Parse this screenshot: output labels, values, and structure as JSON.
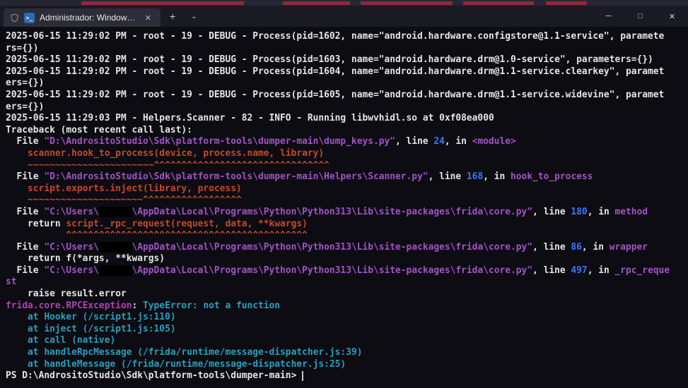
{
  "window": {
    "tab_title": "Administrador: Windows Pow...",
    "tab_icon_glyph": ">_",
    "controls": {
      "tab_close": "✕",
      "new_tab": "+",
      "tab_dropdown": "⌄",
      "minimize": "─",
      "maximize": "□",
      "close": "✕"
    }
  },
  "colors": {
    "terminal_bg": "#0c0c12",
    "titlebar_bg": "#1a1a24",
    "tab_bg": "#2d2d39",
    "text_default": "#e6e6e6",
    "text_path": "#a352c8",
    "text_line_number": "#3b78ff",
    "text_error_code": "#c3492b",
    "text_exception": "#ad41b4",
    "text_cyan": "#2b9fbd"
  },
  "terminal": {
    "lines": [
      [
        {
          "t": "2025-06-15 11:29:02 PM - root - 19 - DEBUG - Process(pid=1602, name=\"android.hardware.configstore@1.1-service\", paramete",
          "c": "fg"
        }
      ],
      [
        {
          "t": "rs={})",
          "c": "fg"
        }
      ],
      [
        {
          "t": "2025-06-15 11:29:02 PM - root - 19 - DEBUG - Process(pid=1603, name=\"android.hardware.drm@1.0-service\", parameters={})",
          "c": "fg"
        }
      ],
      [
        {
          "t": "2025-06-15 11:29:02 PM - root - 19 - DEBUG - Process(pid=1604, name=\"android.hardware.drm@1.1-service.clearkey\", paramet",
          "c": "fg"
        }
      ],
      [
        {
          "t": "ers={})",
          "c": "fg"
        }
      ],
      [
        {
          "t": "2025-06-15 11:29:02 PM - root - 19 - DEBUG - Process(pid=1605, name=\"android.hardware.drm@1.1-service.widevine\", paramet",
          "c": "fg"
        }
      ],
      [
        {
          "t": "ers={})",
          "c": "fg"
        }
      ],
      [
        {
          "t": "2025-06-15 11:29:03 PM - Helpers.Scanner - 82 - INFO - Running libwvhidl.so at 0xf08ea000",
          "c": "fg"
        }
      ],
      [
        {
          "t": "Traceback (most recent call last):",
          "c": "fg"
        }
      ],
      [
        {
          "t": "  File ",
          "c": "fg"
        },
        {
          "t": "\"D:\\AndrositoStudio\\Sdk\\platform-tools\\dumper-main\\dump_keys.py\"",
          "c": "path"
        },
        {
          "t": ", line ",
          "c": "fg"
        },
        {
          "t": "24",
          "c": "num"
        },
        {
          "t": ", in ",
          "c": "fg"
        },
        {
          "t": "<module>",
          "c": "path"
        }
      ],
      [
        {
          "t": "    ",
          "c": "fg"
        },
        {
          "t": "scanner.hook_to_process(device, process.name, library)",
          "c": "code"
        }
      ],
      [
        {
          "t": "    ",
          "c": "fg"
        },
        {
          "t": "~~~~~~~~~~~~~~~~~~~~~~~^^^^^^^^^^^^^^^^^^^^^^^^^^^^^^^^",
          "c": "code"
        }
      ],
      [
        {
          "t": "  File ",
          "c": "fg"
        },
        {
          "t": "\"D:\\AndrositoStudio\\Sdk\\platform-tools\\dumper-main\\Helpers\\Scanner.py\"",
          "c": "path"
        },
        {
          "t": ", line ",
          "c": "fg"
        },
        {
          "t": "168",
          "c": "num"
        },
        {
          "t": ", in ",
          "c": "fg"
        },
        {
          "t": "hook_to_process",
          "c": "path"
        }
      ],
      [
        {
          "t": "    ",
          "c": "fg"
        },
        {
          "t": "script.exports.inject(library, process)",
          "c": "code"
        }
      ],
      [
        {
          "t": "    ",
          "c": "fg"
        },
        {
          "t": "~~~~~~~~~~~~~~~~~~~~~^^^^^^^^^^^^^^^^^^",
          "c": "code"
        }
      ],
      [
        {
          "t": "  File ",
          "c": "fg"
        },
        {
          "t": "\"C:\\Users\\",
          "c": "path"
        },
        {
          "t": "      ",
          "c": "redact"
        },
        {
          "t": "\\AppData\\Local\\Programs\\Python\\Python313\\Lib\\site-packages\\frida\\core.py\"",
          "c": "path"
        },
        {
          "t": ", line ",
          "c": "fg"
        },
        {
          "t": "180",
          "c": "num"
        },
        {
          "t": ", in ",
          "c": "fg"
        },
        {
          "t": "method",
          "c": "path"
        }
      ],
      [
        {
          "t": "    return ",
          "c": "fg"
        },
        {
          "t": "script._rpc_request(request, data, **kwargs)",
          "c": "code"
        }
      ],
      [
        {
          "t": "           ",
          "c": "fg"
        },
        {
          "t": "^^^^^^^^^^^^^^^^^^^^^^^^^^^^^^^^^^^^^^^^^^^^",
          "c": "code"
        }
      ],
      [
        {
          "t": "  File ",
          "c": "fg"
        },
        {
          "t": "\"C:\\Users\\",
          "c": "path"
        },
        {
          "t": "      ",
          "c": "redact"
        },
        {
          "t": "\\AppData\\Local\\Programs\\Python\\Python313\\Lib\\site-packages\\frida\\core.py\"",
          "c": "path"
        },
        {
          "t": ", line ",
          "c": "fg"
        },
        {
          "t": "86",
          "c": "num"
        },
        {
          "t": ", in ",
          "c": "fg"
        },
        {
          "t": "wrapper",
          "c": "path"
        }
      ],
      [
        {
          "t": "    return f(*args, **kwargs)",
          "c": "fg"
        }
      ],
      [
        {
          "t": "  File ",
          "c": "fg"
        },
        {
          "t": "\"C:\\Users\\",
          "c": "path"
        },
        {
          "t": "      ",
          "c": "redact"
        },
        {
          "t": "\\AppData\\Local\\Programs\\Python\\Python313\\Lib\\site-packages\\frida\\core.py\"",
          "c": "path"
        },
        {
          "t": ", line ",
          "c": "fg"
        },
        {
          "t": "497",
          "c": "num"
        },
        {
          "t": ", in ",
          "c": "fg"
        },
        {
          "t": "_rpc_reque",
          "c": "path"
        }
      ],
      [
        {
          "t": "st",
          "c": "path"
        }
      ],
      [
        {
          "t": "    raise result.error",
          "c": "fg"
        }
      ],
      [
        {
          "t": "frida.core.RPCException",
          "c": "mag"
        },
        {
          "t": ": ",
          "c": "fg"
        },
        {
          "t": "TypeError: not a function",
          "c": "cyan"
        }
      ],
      [
        {
          "t": "    at Hooker (/script1.js:110)",
          "c": "cyan"
        }
      ],
      [
        {
          "t": "    at inject (/script1.js:105)",
          "c": "cyan"
        }
      ],
      [
        {
          "t": "    at call (native)",
          "c": "cyan"
        }
      ],
      [
        {
          "t": "    at handleRpcMessage (/frida/runtime/message-dispatcher.js:39)",
          "c": "cyan"
        }
      ],
      [
        {
          "t": "    at handleMessage (/frida/runtime/message-dispatcher.js:25)",
          "c": "cyan"
        }
      ],
      [
        {
          "t": "PS D:\\AndrositoStudio\\Sdk\\platform-tools\\dumper-main> ",
          "c": "fg"
        },
        {
          "t": "",
          "c": "cursor"
        }
      ]
    ]
  }
}
